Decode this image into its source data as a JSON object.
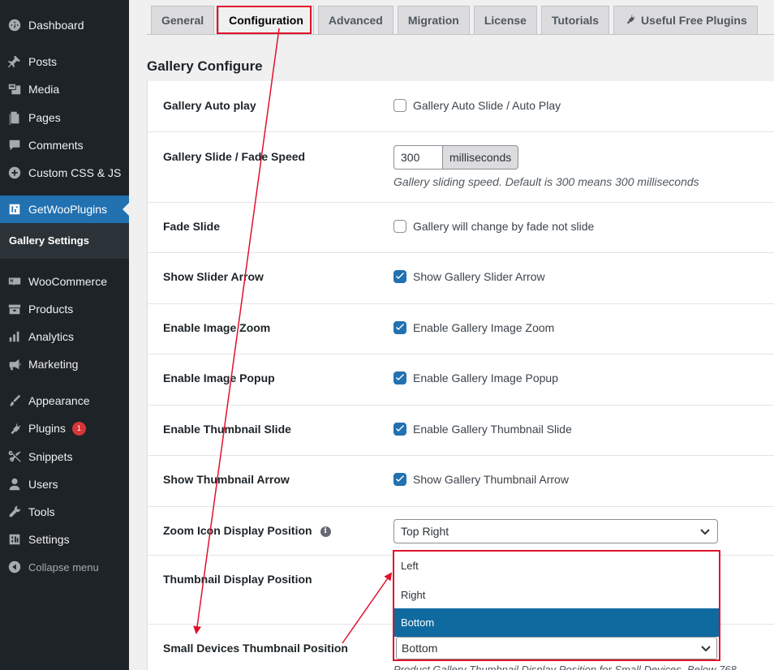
{
  "sidebar": {
    "items": [
      {
        "label": "Dashboard",
        "icon": "dashboard-icon"
      },
      {
        "label": "Posts",
        "icon": "pin-icon"
      },
      {
        "label": "Media",
        "icon": "media-icon"
      },
      {
        "label": "Pages",
        "icon": "pages-icon"
      },
      {
        "label": "Comments",
        "icon": "comments-icon"
      },
      {
        "label": "Custom CSS & JS",
        "icon": "plus-circle-icon"
      },
      {
        "label": "GetWooPlugins",
        "icon": "plugin-box-icon"
      },
      {
        "label": "WooCommerce",
        "icon": "woo-icon"
      },
      {
        "label": "Products",
        "icon": "products-icon"
      },
      {
        "label": "Analytics",
        "icon": "analytics-icon"
      },
      {
        "label": "Marketing",
        "icon": "megaphone-icon"
      },
      {
        "label": "Appearance",
        "icon": "brush-icon"
      },
      {
        "label": "Plugins",
        "icon": "plug-icon",
        "badge": "1"
      },
      {
        "label": "Snippets",
        "icon": "scissors-icon"
      },
      {
        "label": "Users",
        "icon": "user-icon"
      },
      {
        "label": "Tools",
        "icon": "wrench-icon"
      },
      {
        "label": "Settings",
        "icon": "settings-icon"
      },
      {
        "label": "Collapse menu",
        "icon": "collapse-icon"
      }
    ],
    "active_index": 6,
    "submenu_label": "Gallery Settings"
  },
  "tabs": [
    "General",
    "Configuration",
    "Advanced",
    "Migration",
    "License",
    "Tutorials",
    "Useful Free Plugins"
  ],
  "active_tab": "Configuration",
  "section_title": "Gallery Configure",
  "rows": {
    "autoplay": {
      "label": "Gallery Auto play",
      "text": "Gallery Auto Slide / Auto Play",
      "checked": false
    },
    "speed": {
      "label": "Gallery Slide / Fade Speed",
      "value": "300",
      "unit": "milliseconds",
      "desc": "Gallery sliding speed. Default is 300 means 300 milliseconds"
    },
    "fade": {
      "label": "Fade Slide",
      "text": "Gallery will change by fade not slide",
      "checked": false
    },
    "arrow": {
      "label": "Show Slider Arrow",
      "text": "Show Gallery Slider Arrow",
      "checked": true
    },
    "zoom": {
      "label": "Enable Image Zoom",
      "text": "Enable Gallery Image Zoom",
      "checked": true
    },
    "popup": {
      "label": "Enable Image Popup",
      "text": "Enable Gallery Image Popup",
      "checked": true
    },
    "thumbslide": {
      "label": "Enable Thumbnail Slide",
      "text": "Enable Gallery Thumbnail Slide",
      "checked": true
    },
    "thumbarrow": {
      "label": "Show Thumbnail Arrow",
      "text": "Show Gallery Thumbnail Arrow",
      "checked": true
    },
    "zoompos": {
      "label": "Zoom Icon Display Position",
      "value": "Top Right"
    },
    "thumbpos": {
      "label": "Thumbnail Display Position"
    },
    "smallthumb": {
      "label": "Small Devices Thumbnail Position",
      "value": "Bottom",
      "desc": "Product Gallery Thumbnail Display Position for Small Devices. Below 768"
    }
  },
  "dropdown": {
    "options": [
      "Left",
      "Right",
      "Bottom"
    ],
    "selected": "Bottom"
  },
  "colors": {
    "accent": "#2271b1",
    "annotation": "#e0112b",
    "sidebar": "#1d2327"
  }
}
